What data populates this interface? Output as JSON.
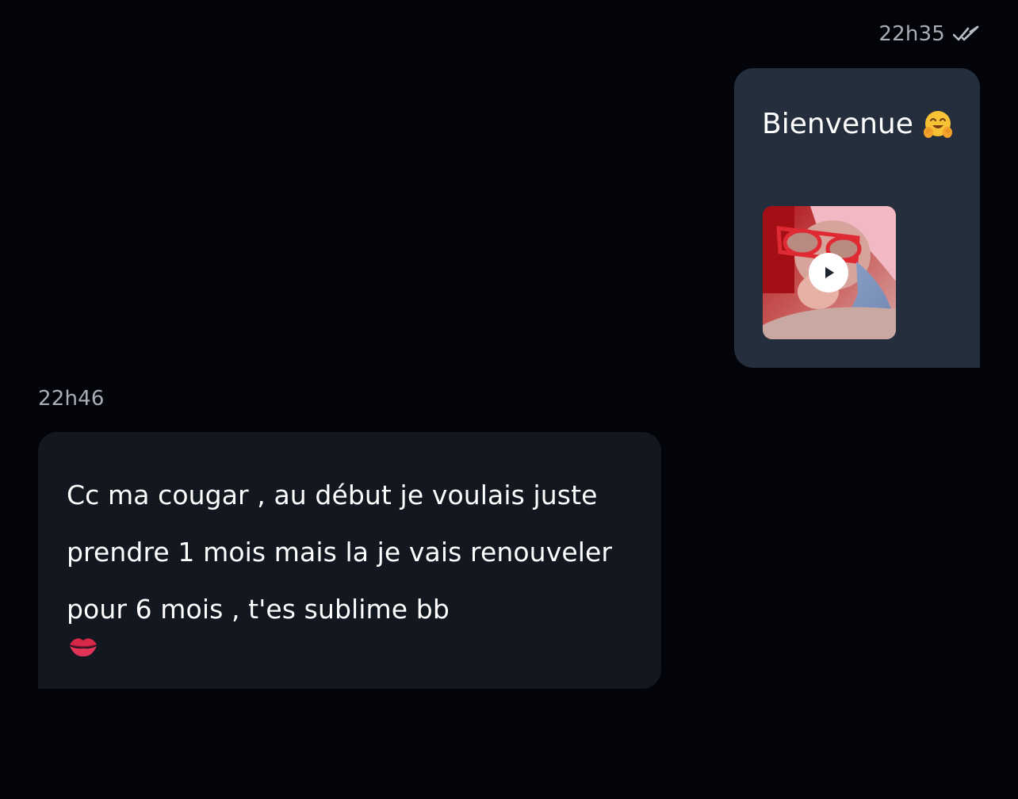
{
  "messages": {
    "outgoing": {
      "time": "22h35",
      "text": "Bienvenue",
      "emoji": "smiling-face-with-open-hands",
      "status_icon": "double-check-icon",
      "media": {
        "type": "video",
        "icon": "play-icon"
      }
    },
    "incoming": {
      "time": "22h46",
      "text": "Cc ma cougar , au début je voulais juste prendre 1 mois mais la je vais renouveler pour 6 mois , t'es sublime bb",
      "emoji": "kiss-mark"
    }
  },
  "colors": {
    "background": "#03040a",
    "outgoing_bubble": "#252e3d",
    "incoming_bubble": "#131720",
    "timestamp": "#a9adb6",
    "text": "#ffffff"
  }
}
